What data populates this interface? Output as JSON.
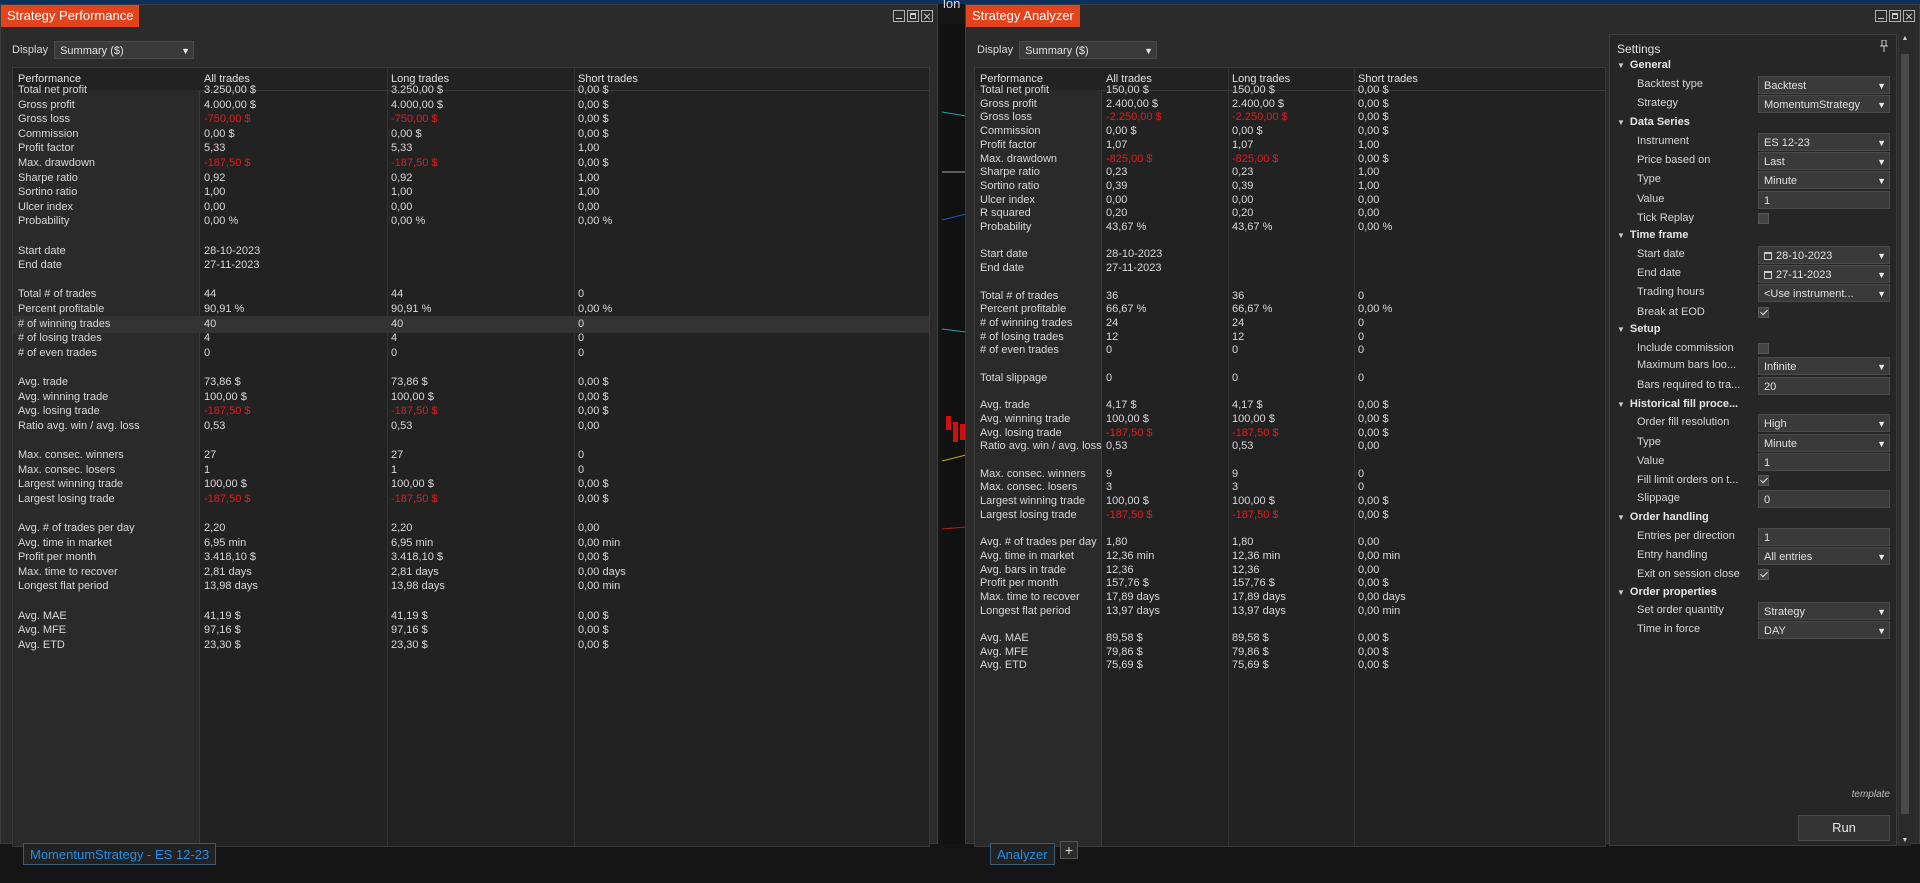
{
  "background_text": "lon",
  "perf_window": {
    "title": "Strategy Performance",
    "display_label": "Display",
    "display_value": "Summary ($)",
    "columns": [
      "Performance",
      "All trades",
      "Long trades",
      "Short trades"
    ],
    "rows": [
      {
        "label": "Total net profit",
        "all": "3.250,00 $",
        "long": "3.250,00 $",
        "short": "0,00 $"
      },
      {
        "label": "Gross profit",
        "all": "4.000,00 $",
        "long": "4.000,00 $",
        "short": "0,00 $"
      },
      {
        "label": "Gross loss",
        "all": "-750,00 $",
        "long": "-750,00 $",
        "short": "0,00 $",
        "neg": true
      },
      {
        "label": "Commission",
        "all": "0,00 $",
        "long": "0,00 $",
        "short": "0,00 $"
      },
      {
        "label": "Profit factor",
        "all": "5,33",
        "long": "5,33",
        "short": "1,00"
      },
      {
        "label": "Max. drawdown",
        "all": "-187,50 $",
        "long": "-187,50 $",
        "short": "0,00 $",
        "neg": true
      },
      {
        "label": "Sharpe ratio",
        "all": "0,92",
        "long": "0,92",
        "short": "1,00"
      },
      {
        "label": "Sortino ratio",
        "all": "1,00",
        "long": "1,00",
        "short": "1,00"
      },
      {
        "label": "Ulcer index",
        "all": "0,00",
        "long": "0,00",
        "short": "0,00"
      },
      {
        "label": "Probability",
        "all": "0,00 %",
        "long": "0,00 %",
        "short": "0,00 %"
      },
      {
        "label": "",
        "all": "",
        "long": "",
        "short": ""
      },
      {
        "label": "Start date",
        "all": "28-10-2023",
        "long": "",
        "short": ""
      },
      {
        "label": "End date",
        "all": "27-11-2023",
        "long": "",
        "short": ""
      },
      {
        "label": "",
        "all": "",
        "long": "",
        "short": ""
      },
      {
        "label": "Total # of trades",
        "all": "44",
        "long": "44",
        "short": "0"
      },
      {
        "label": "Percent profitable",
        "all": "90,91 %",
        "long": "90,91 %",
        "short": "0,00 %"
      },
      {
        "label": "# of winning trades",
        "all": "40",
        "long": "40",
        "short": "0",
        "hl": true
      },
      {
        "label": "# of losing trades",
        "all": "4",
        "long": "4",
        "short": "0"
      },
      {
        "label": "# of even trades",
        "all": "0",
        "long": "0",
        "short": "0"
      },
      {
        "label": "",
        "all": "",
        "long": "",
        "short": ""
      },
      {
        "label": "Avg. trade",
        "all": "73,86 $",
        "long": "73,86 $",
        "short": "0,00 $"
      },
      {
        "label": "Avg. winning trade",
        "all": "100,00 $",
        "long": "100,00 $",
        "short": "0,00 $"
      },
      {
        "label": "Avg. losing trade",
        "all": "-187,50 $",
        "long": "-187,50 $",
        "short": "0,00 $",
        "neg": true
      },
      {
        "label": "Ratio avg. win / avg. loss",
        "all": "0,53",
        "long": "0,53",
        "short": "0,00"
      },
      {
        "label": "",
        "all": "",
        "long": "",
        "short": ""
      },
      {
        "label": "Max. consec. winners",
        "all": "27",
        "long": "27",
        "short": "0"
      },
      {
        "label": "Max. consec. losers",
        "all": "1",
        "long": "1",
        "short": "0"
      },
      {
        "label": "Largest winning trade",
        "all": "100,00 $",
        "long": "100,00 $",
        "short": "0,00 $"
      },
      {
        "label": "Largest losing trade",
        "all": "-187,50 $",
        "long": "-187,50 $",
        "short": "0,00 $",
        "neg": true
      },
      {
        "label": "",
        "all": "",
        "long": "",
        "short": ""
      },
      {
        "label": "Avg. # of trades per day",
        "all": "2,20",
        "long": "2,20",
        "short": "0,00"
      },
      {
        "label": "Avg. time in market",
        "all": "6,95 min",
        "long": "6,95 min",
        "short": "0,00 min"
      },
      {
        "label": "Profit per month",
        "all": "3.418,10 $",
        "long": "3.418,10 $",
        "short": "0,00 $"
      },
      {
        "label": "Max. time to recover",
        "all": "2,81 days",
        "long": "2,81 days",
        "short": "0,00 days"
      },
      {
        "label": "Longest flat period",
        "all": "13,98 days",
        "long": "13,98 days",
        "short": "0,00 min"
      },
      {
        "label": "",
        "all": "",
        "long": "",
        "short": ""
      },
      {
        "label": "Avg. MAE",
        "all": "41,19 $",
        "long": "41,19 $",
        "short": "0,00 $"
      },
      {
        "label": "Avg. MFE",
        "all": "97,16 $",
        "long": "97,16 $",
        "short": "0,00 $"
      },
      {
        "label": "Avg. ETD",
        "all": "23,30 $",
        "long": "23,30 $",
        "short": "0,00 $"
      }
    ],
    "bottom_tab": "MomentumStrategy - ES 12-23"
  },
  "analyzer_window": {
    "title": "Strategy Analyzer",
    "display_label": "Display",
    "display_value": "Summary ($)",
    "columns": [
      "Performance",
      "All trades",
      "Long trades",
      "Short trades"
    ],
    "rows": [
      {
        "label": "Total net profit",
        "all": "150,00 $",
        "long": "150,00 $",
        "short": "0,00 $"
      },
      {
        "label": "Gross profit",
        "all": "2.400,00 $",
        "long": "2.400,00 $",
        "short": "0,00 $"
      },
      {
        "label": "Gross loss",
        "all": "-2.250,00 $",
        "long": "-2.250,00 $",
        "short": "0,00 $",
        "neg": true
      },
      {
        "label": "Commission",
        "all": "0,00 $",
        "long": "0,00 $",
        "short": "0,00 $"
      },
      {
        "label": "Profit factor",
        "all": "1,07",
        "long": "1,07",
        "short": "1,00"
      },
      {
        "label": "Max. drawdown",
        "all": "-825,00 $",
        "long": "-825,00 $",
        "short": "0,00 $",
        "neg": true
      },
      {
        "label": "Sharpe ratio",
        "all": "0,23",
        "long": "0,23",
        "short": "1,00"
      },
      {
        "label": "Sortino ratio",
        "all": "0,39",
        "long": "0,39",
        "short": "1,00"
      },
      {
        "label": "Ulcer index",
        "all": "0,00",
        "long": "0,00",
        "short": "0,00"
      },
      {
        "label": "R squared",
        "all": "0,20",
        "long": "0,20",
        "short": "0,00"
      },
      {
        "label": "Probability",
        "all": "43,67 %",
        "long": "43,67 %",
        "short": "0,00 %"
      },
      {
        "label": "",
        "all": "",
        "long": "",
        "short": ""
      },
      {
        "label": "Start date",
        "all": "28-10-2023",
        "long": "",
        "short": ""
      },
      {
        "label": "End date",
        "all": "27-11-2023",
        "long": "",
        "short": ""
      },
      {
        "label": "",
        "all": "",
        "long": "",
        "short": ""
      },
      {
        "label": "Total # of trades",
        "all": "36",
        "long": "36",
        "short": "0"
      },
      {
        "label": "Percent profitable",
        "all": "66,67 %",
        "long": "66,67 %",
        "short": "0,00 %"
      },
      {
        "label": "# of winning trades",
        "all": "24",
        "long": "24",
        "short": "0"
      },
      {
        "label": "# of losing trades",
        "all": "12",
        "long": "12",
        "short": "0"
      },
      {
        "label": "# of even trades",
        "all": "0",
        "long": "0",
        "short": "0"
      },
      {
        "label": "",
        "all": "",
        "long": "",
        "short": ""
      },
      {
        "label": "Total slippage",
        "all": "0",
        "long": "0",
        "short": "0"
      },
      {
        "label": "",
        "all": "",
        "long": "",
        "short": ""
      },
      {
        "label": "Avg. trade",
        "all": "4,17 $",
        "long": "4,17 $",
        "short": "0,00 $"
      },
      {
        "label": "Avg. winning trade",
        "all": "100,00 $",
        "long": "100,00 $",
        "short": "0,00 $"
      },
      {
        "label": "Avg. losing trade",
        "all": "-187,50 $",
        "long": "-187,50 $",
        "short": "0,00 $",
        "neg": true
      },
      {
        "label": "Ratio avg. win / avg. loss",
        "all": "0,53",
        "long": "0,53",
        "short": "0,00"
      },
      {
        "label": "",
        "all": "",
        "long": "",
        "short": ""
      },
      {
        "label": "Max. consec. winners",
        "all": "9",
        "long": "9",
        "short": "0"
      },
      {
        "label": "Max. consec. losers",
        "all": "3",
        "long": "3",
        "short": "0"
      },
      {
        "label": "Largest winning trade",
        "all": "100,00 $",
        "long": "100,00 $",
        "short": "0,00 $"
      },
      {
        "label": "Largest losing trade",
        "all": "-187,50 $",
        "long": "-187,50 $",
        "short": "0,00 $",
        "neg": true
      },
      {
        "label": "",
        "all": "",
        "long": "",
        "short": ""
      },
      {
        "label": "Avg. # of trades per day",
        "all": "1,80",
        "long": "1,80",
        "short": "0,00"
      },
      {
        "label": "Avg. time in market",
        "all": "12,36 min",
        "long": "12,36 min",
        "short": "0,00 min"
      },
      {
        "label": "Avg. bars in trade",
        "all": "12,36",
        "long": "12,36",
        "short": "0,00"
      },
      {
        "label": "Profit per month",
        "all": "157,76 $",
        "long": "157,76 $",
        "short": "0,00 $"
      },
      {
        "label": "Max. time to recover",
        "all": "17,89 days",
        "long": "17,89 days",
        "short": "0,00 days"
      },
      {
        "label": "Longest flat period",
        "all": "13,97 days",
        "long": "13,97 days",
        "short": "0,00 min"
      },
      {
        "label": "",
        "all": "",
        "long": "",
        "short": ""
      },
      {
        "label": "Avg. MAE",
        "all": "89,58 $",
        "long": "89,58 $",
        "short": "0,00 $"
      },
      {
        "label": "Avg. MFE",
        "all": "79,86 $",
        "long": "79,86 $",
        "short": "0,00 $"
      },
      {
        "label": "Avg. ETD",
        "all": "75,69 $",
        "long": "75,69 $",
        "short": "0,00 $"
      }
    ],
    "bottom_tab": "Analyzer",
    "add_tab": "+"
  },
  "settings": {
    "title": "Settings",
    "template_label": "template",
    "run_label": "Run",
    "sections": [
      {
        "name": "General",
        "props": [
          {
            "label": "Backtest type",
            "kind": "select",
            "value": "Backtest"
          },
          {
            "label": "Strategy",
            "kind": "select",
            "value": "MomentumStrategy"
          }
        ]
      },
      {
        "name": "Data Series",
        "props": [
          {
            "label": "Instrument",
            "kind": "select",
            "value": "ES 12-23"
          },
          {
            "label": "Price based on",
            "kind": "select",
            "value": "Last"
          },
          {
            "label": "Type",
            "kind": "select",
            "value": "Minute"
          },
          {
            "label": "Value",
            "kind": "text",
            "value": "1"
          },
          {
            "label": "Tick Replay",
            "kind": "check",
            "value": false
          }
        ]
      },
      {
        "name": "Time frame",
        "props": [
          {
            "label": "Start date",
            "kind": "date",
            "value": "28-10-2023"
          },
          {
            "label": "End date",
            "kind": "date",
            "value": "27-11-2023"
          },
          {
            "label": "Trading hours",
            "kind": "select",
            "value": "<Use instrument..."
          },
          {
            "label": "Break at EOD",
            "kind": "check",
            "value": true
          }
        ]
      },
      {
        "name": "Setup",
        "props": [
          {
            "label": "Include commission",
            "kind": "check",
            "value": false
          },
          {
            "label": "Maximum bars loo...",
            "kind": "select",
            "value": "Infinite"
          },
          {
            "label": "Bars required to tra...",
            "kind": "text",
            "value": "20"
          }
        ]
      },
      {
        "name": "Historical fill proce...",
        "props": [
          {
            "label": "Order fill resolution",
            "kind": "select",
            "value": "High"
          },
          {
            "label": "Type",
            "kind": "select",
            "value": "Minute"
          },
          {
            "label": "Value",
            "kind": "text",
            "value": "1"
          },
          {
            "label": "Fill limit orders on t...",
            "kind": "check",
            "value": true
          },
          {
            "label": "Slippage",
            "kind": "text",
            "value": "0"
          }
        ]
      },
      {
        "name": "Order handling",
        "props": [
          {
            "label": "Entries per direction",
            "kind": "text",
            "value": "1"
          },
          {
            "label": "Entry handling",
            "kind": "select",
            "value": "All entries"
          },
          {
            "label": "Exit on session close",
            "kind": "check",
            "value": true
          }
        ]
      },
      {
        "name": "Order properties",
        "props": [
          {
            "label": "Set order quantity",
            "kind": "select",
            "value": "Strategy"
          },
          {
            "label": "Time in force",
            "kind": "select",
            "value": "DAY"
          }
        ]
      }
    ]
  }
}
